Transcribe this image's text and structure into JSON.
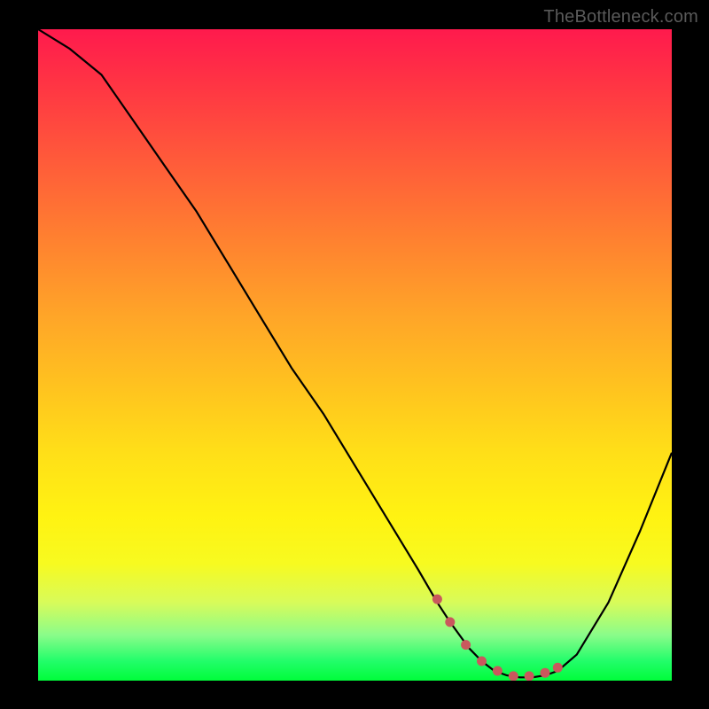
{
  "watermark": "TheBottleneck.com",
  "chart_data": {
    "type": "line",
    "title": "",
    "xlabel": "",
    "ylabel": "",
    "xlim": [
      0,
      100
    ],
    "ylim": [
      0,
      100
    ],
    "series": [
      {
        "name": "bottleneck-curve",
        "x": [
          0,
          5,
          10,
          15,
          20,
          25,
          30,
          35,
          40,
          45,
          50,
          55,
          60,
          63,
          65,
          68,
          70,
          72,
          74,
          76,
          78,
          80,
          82,
          85,
          90,
          95,
          100
        ],
        "y": [
          100,
          97,
          93,
          86,
          79,
          72,
          64,
          56,
          48,
          41,
          33,
          25,
          17,
          12,
          9,
          5,
          3,
          1.5,
          0.8,
          0.5,
          0.5,
          0.8,
          1.5,
          4,
          12,
          23,
          35
        ]
      }
    ],
    "markers": {
      "name": "valley-markers",
      "x": [
        63,
        65,
        67.5,
        70,
        72.5,
        75,
        77.5,
        80,
        82
      ],
      "y": [
        12.5,
        9.0,
        5.5,
        3.0,
        1.5,
        0.7,
        0.7,
        1.2,
        2.0
      ]
    },
    "gradient_stops": [
      {
        "pos": 0,
        "color": "#ff1a4d"
      },
      {
        "pos": 20,
        "color": "#ff5a3a"
      },
      {
        "pos": 44,
        "color": "#ffa528"
      },
      {
        "pos": 65,
        "color": "#ffdf18"
      },
      {
        "pos": 82,
        "color": "#f7fa20"
      },
      {
        "pos": 93,
        "color": "#8afc8a"
      },
      {
        "pos": 100,
        "color": "#00fd3a"
      }
    ]
  }
}
